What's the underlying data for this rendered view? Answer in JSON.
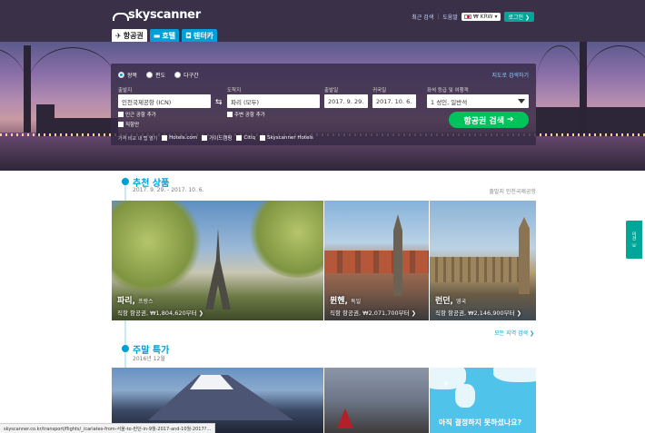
{
  "header": {
    "logo": "skyscanner",
    "recent_searches": "최근 검색",
    "help": "도움말",
    "currency": "₩ KRW",
    "login": "로그인"
  },
  "tabs": [
    {
      "label": "항공권",
      "icon": "airplane-icon"
    },
    {
      "label": "호텔",
      "icon": "bed-icon"
    },
    {
      "label": "렌터카",
      "icon": "car-icon"
    }
  ],
  "search": {
    "trip_types": [
      "왕복",
      "편도",
      "다구간"
    ],
    "multi_city_link": "지도로 검색하기",
    "from_label": "출발지",
    "from_value": "인천국제공항 (ICN)",
    "to_label": "도착지",
    "to_value": "파리 (모두)",
    "depart_label": "출발일",
    "depart_value": "2017. 9. 29.",
    "return_label": "귀국일",
    "return_value": "2017. 10. 6.",
    "cabin_label": "좌석 등급 및 여행객",
    "cabin_value": "1 성인, 일반석",
    "nearby_from": "인근 공항 추가",
    "nearby_to": "주변 공항 추가",
    "direct_only": "직항만",
    "search_button": "항공권 검색",
    "compare_label": "가격 비교 내 탭 열기",
    "compare_options": [
      "Hotels.com",
      "가이드캠핑",
      "Citiq",
      "Skyscanner Hotels"
    ]
  },
  "featured": {
    "title": "추천 상품",
    "dates": "2017. 9. 29. - 2017. 10. 6.",
    "origin": "출발지 인천국제공항",
    "cards": [
      {
        "city": "파리,",
        "country": "프랑스",
        "price": "직항 항공권, ₩1,804,620부터 ❯"
      },
      {
        "city": "뮌헨,",
        "country": "독일",
        "price": "직항 항공권, ₩2,071,700부터 ❯"
      },
      {
        "city": "런던,",
        "country": "영국",
        "price": "직항 항공권, ₩2,146,900부터 ❯"
      }
    ],
    "more_link": "모든 지역 검색 ❯"
  },
  "weekend": {
    "title": "주말 특가",
    "subtitle": "2016년 12월",
    "map_card_text": "아직 결정하지 못하셨나요?"
  },
  "feedback": {
    "label": "의견"
  },
  "status_url": "skyscanner.co.kr/transport/flights/_/cariates-from-서울-to-런던-in-9월-2017-and-10월-2017?..."
}
